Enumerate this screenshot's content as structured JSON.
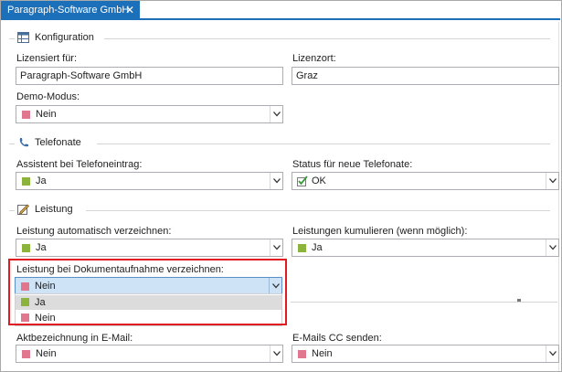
{
  "tab": {
    "title": "Paragraph-Software GmbH",
    "close_label": "✕"
  },
  "konfiguration": {
    "title": "Konfiguration",
    "lizensiert_label": "Lizensiert für:",
    "lizensiert_value": "Paragraph-Software GmbH",
    "lizenzort_label": "Lizenzort:",
    "lizenzort_value": "Graz",
    "demo_label": "Demo-Modus:",
    "demo_value": "Nein"
  },
  "telefonate": {
    "title": "Telefonate",
    "assistent_label": "Assistent bei Telefoneintrag:",
    "assistent_value": "Ja",
    "status_label": "Status für neue Telefonate:",
    "status_value": "OK"
  },
  "leistung": {
    "title": "Leistung",
    "auto_label": "Leistung automatisch verzeichnen:",
    "auto_value": "Ja",
    "kumulieren_label": "Leistungen kumulieren (wenn möglich):",
    "kumulieren_value": "Ja",
    "dokument_label": "Leistung bei Dokumentaufnahme verzeichnen:",
    "dokument_value": "Nein",
    "options": [
      {
        "label": "Ja",
        "color": "#8cb43c"
      },
      {
        "label": "Nein",
        "color": "#e0778e"
      }
    ]
  },
  "email": {
    "akt_label": "Aktbezeichnung in E-Mail:",
    "akt_value": "Nein",
    "cc_label": "E-Mails CC senden:",
    "cc_value": "Nein"
  },
  "colors": {
    "accent": "#1c6fb9",
    "yes": "#8cb43c",
    "no": "#e0778e",
    "highlight": "#e01b22"
  }
}
